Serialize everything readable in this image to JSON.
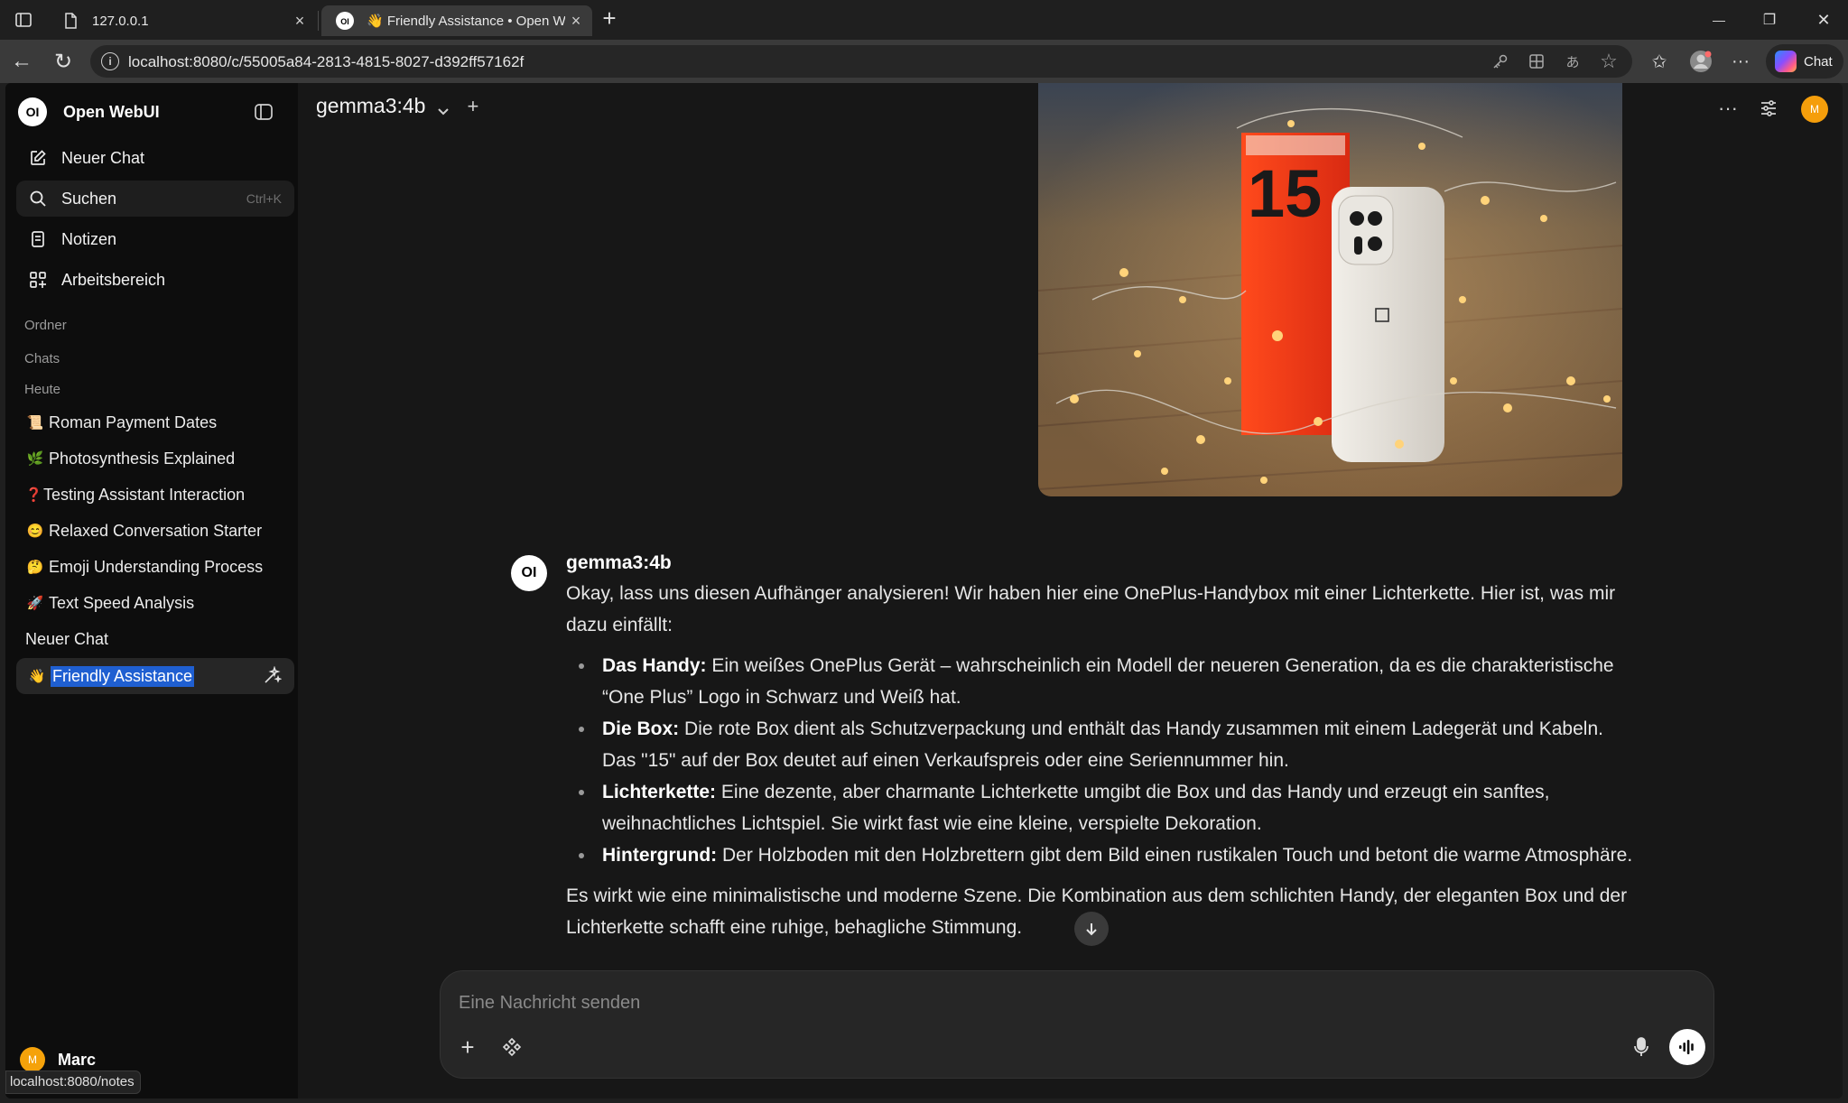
{
  "browser": {
    "tabs": [
      {
        "title": "127.0.0.1"
      },
      {
        "title": "👋 Friendly Assistance • Open W"
      }
    ],
    "url": "localhost:8080/c/55005a84-2813-4815-8027-d392ff57162f",
    "copilot_label": "Chat",
    "new_tab_symbol": "+",
    "close_symbol": "×",
    "window_controls": {
      "minimize": "—",
      "restore": "❐",
      "close": "✕"
    },
    "nav": {
      "back": "←",
      "reload": "↻",
      "more": "···"
    }
  },
  "sidebar": {
    "brand_logo": "OI",
    "brand_name": "Open WebUI",
    "nav": [
      {
        "label": "Neuer Chat",
        "icon": "edit-icon"
      },
      {
        "label": "Suchen",
        "icon": "search-icon",
        "shortcut": "Ctrl+K"
      },
      {
        "label": "Notizen",
        "icon": "notes-icon"
      },
      {
        "label": "Arbeitsbereich",
        "icon": "workspace-icon"
      }
    ],
    "sections": {
      "folders": "Ordner",
      "chats": "Chats",
      "today": "Heute"
    },
    "chats": [
      {
        "emoji": "📜",
        "title": "Roman Payment Dates"
      },
      {
        "emoji": "🌿",
        "title": "Photosynthesis Explained"
      },
      {
        "emoji": "❓",
        "title": "Testing Assistant Interaction"
      },
      {
        "emoji": "😊",
        "title": "Relaxed Conversation Starter"
      },
      {
        "emoji": "🤔",
        "title": "Emoji Understanding Process"
      },
      {
        "emoji": "🚀",
        "title": "Text Speed Analysis"
      }
    ],
    "new_chat_plain": "Neuer Chat",
    "active_chat": {
      "emoji": "👋",
      "title": "Friendly Assistance"
    },
    "user": {
      "initial": "M",
      "name": "Marc"
    },
    "status_url": "localhost:8080/notes"
  },
  "header": {
    "model": "gemma3:4b",
    "add_symbol": "+",
    "avatar_initial": "M",
    "more_symbol": "···"
  },
  "message": {
    "avatar": "OI",
    "model": "gemma3:4b",
    "intro": "Okay, lass uns diesen Aufhänger analysieren! Wir haben hier eine OnePlus-Handybox mit einer Lichterkette. Hier ist, was mir dazu einfällt:",
    "bullets": [
      {
        "term": "Das Handy:",
        "text": " Ein weißes OnePlus Gerät – wahrscheinlich ein Modell der neueren Generation, da es die charakteristische “One Plus” Logo in Schwarz und Weiß hat."
      },
      {
        "term": "Die Box:",
        "text": " Die rote Box dient als Schutzverpackung und enthält das Handy zusammen mit einem Ladegerät und Kabeln. Das \"15\" auf der Box deutet auf einen Verkaufspreis oder eine Seriennummer hin."
      },
      {
        "term": "Lichterkette:",
        "text": " Eine dezente, aber charmante Lichterkette umgibt die Box und das Handy und erzeugt ein sanftes, weihnachtliches Lichtspiel. Sie wirkt fast wie eine kleine, verspielte Dekoration."
      },
      {
        "term": "Hintergrund:",
        "text": " Der Holzboden mit den Holzbrettern gibt dem Bild einen rustikalen Touch und betont die warme Atmosphäre."
      }
    ],
    "outro": "Es wirkt wie eine minimalistische und moderne Szene. Die Kombination aus dem schlichten Handy, der eleganten Box und der Lichterkette schafft eine ruhige, behagliche Stimmung.",
    "image": {
      "box_number": "15"
    }
  },
  "composer": {
    "placeholder": "Eine Nachricht senden",
    "add_symbol": "+"
  },
  "colors": {
    "accent_orange": "#f59e0b",
    "selection_blue": "#1f5fd1",
    "sidebar_bg": "#0d0d0d",
    "main_bg": "#171717"
  }
}
